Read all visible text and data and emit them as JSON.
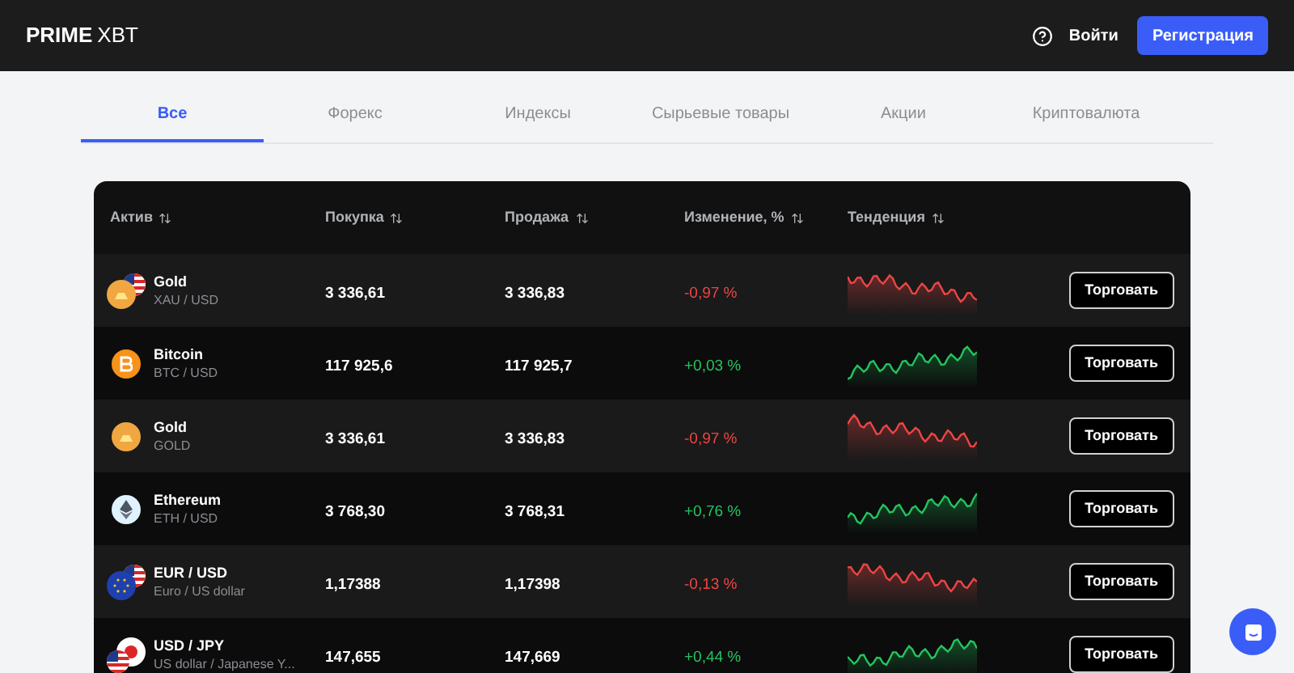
{
  "header": {
    "logo": {
      "primary": "PRIME",
      "secondary": "XBT"
    },
    "login": "Войти",
    "register": "Регистрация"
  },
  "tabs": [
    {
      "label": "Все",
      "selected": true
    },
    {
      "label": "Форекс",
      "selected": false
    },
    {
      "label": "Индексы",
      "selected": false
    },
    {
      "label": "Сырьевые товары",
      "selected": false
    },
    {
      "label": "Акции",
      "selected": false
    },
    {
      "label": "Криптовалюта",
      "selected": false
    }
  ],
  "table": {
    "columns": [
      "Актив",
      "Покупка",
      "Продажа",
      "Изменение, %",
      "Тенденция"
    ],
    "rows": [
      {
        "kind": "goldusd",
        "name": "Gold",
        "pair": "XAU / USD",
        "buy": "3 336,61",
        "sell": "3 336,83",
        "change": "-0,97 %",
        "color": "#ef4444",
        "action": "Торговать"
      },
      {
        "kind": "bitcoin",
        "name": "Bitcoin",
        "pair": "BTC / USD",
        "buy": "117 925,6",
        "sell": "117 925,7",
        "change": "+0,03 %",
        "color": "#22c55e",
        "action": "Торговать"
      },
      {
        "kind": "gold",
        "name": "Gold",
        "pair": "GOLD",
        "buy": "3 336,61",
        "sell": "3 336,83",
        "change": "-0,97 %",
        "color": "#ef4444",
        "action": "Торговать"
      },
      {
        "kind": "ethereum",
        "name": "Ethereum",
        "pair": "ETH / USD",
        "buy": "3 768,30",
        "sell": "3 768,31",
        "change": "+0,76 %",
        "color": "#22c55e",
        "action": "Торговать"
      },
      {
        "kind": "eurusd",
        "name": "EUR / USD",
        "pair": "Euro / US dollar",
        "buy": "1,17388",
        "sell": "1,17398",
        "change": "-0,13 %",
        "color": "#ef4444",
        "action": "Торговать"
      },
      {
        "kind": "usdjpy",
        "name": "USD / JPY",
        "pair": "US dollar / Japanese Y...",
        "buy": "147,655",
        "sell": "147,669",
        "change": "+0,44 %",
        "color": "#22c55e",
        "action": "Торговать"
      }
    ]
  }
}
